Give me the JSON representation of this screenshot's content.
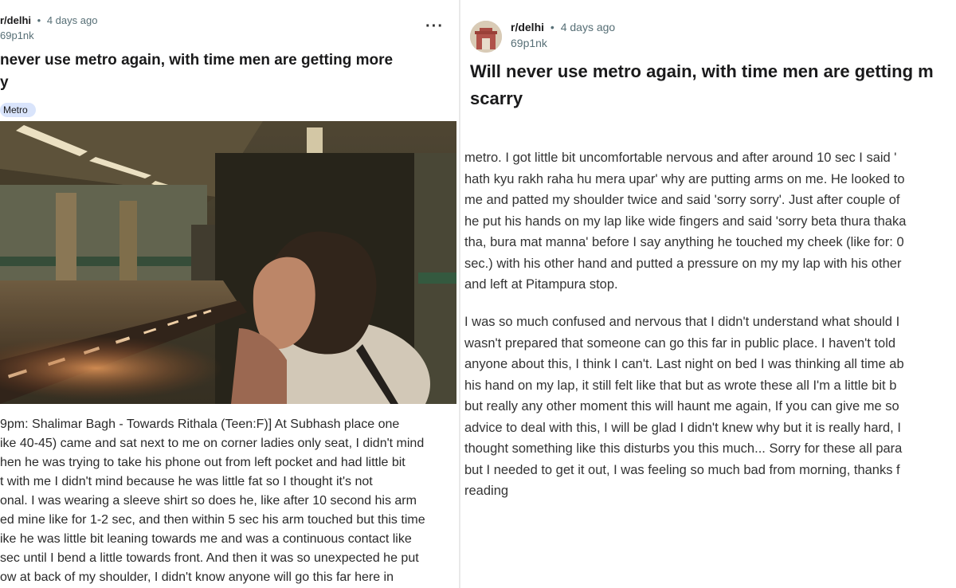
{
  "left": {
    "subreddit": "r/delhi",
    "separator": "•",
    "age": "4 days ago",
    "username": "69p1nk",
    "more_label": "···",
    "title_lines": [
      "never use metro again, with time men are getting more",
      "y"
    ],
    "flair": "Metro",
    "body_lines": [
      "9pm: Shalimar Bagh - Towards Rithala (Teen:F)] At Subhash place one",
      "ike 40-45) came and sat next to me on corner ladies only seat, I didn't mind",
      "hen he was trying to take his phone out from left pocket and had little bit",
      "t with me I didn't mind because he was little fat so I thought it's not",
      "onal. I was wearing a sleeve shirt so does he, like after 10 second his arm",
      "ed mine like for 1-2 sec, and then within 5 sec his arm touched but this time",
      "ike he was little bit leaning towards me and was a continuous contact like",
      "sec until I bend a little towards front. And then it was so unexpected he put",
      "ow at back of my shoulder, I didn't know anyone will go this far here in"
    ]
  },
  "right": {
    "subreddit": "r/delhi",
    "separator": "•",
    "age": "4 days ago",
    "username": "69p1nk",
    "title_lines": [
      "Will never use metro again, with time men are getting m",
      "scarry"
    ],
    "paragraph1": [
      "metro. I got little bit uncomfortable nervous and after around 10 sec I said '",
      "hath kyu rakh raha hu mera upar' why are putting arms on me. He looked to",
      "me and patted my shoulder twice and said 'sorry sorry'. Just after couple of",
      "he put his hands on my lap like wide fingers and said 'sorry beta thura thaka",
      "tha, bura mat manna' before I say anything he touched my cheek (like for: 0",
      "sec.) with his other hand and putted a pressure on my my lap with his other",
      "and left at Pitampura stop."
    ],
    "paragraph2": [
      "I was so much confused and nervous that I didn't understand what should I",
      "wasn't prepared that someone can go this far in public place. I haven't told",
      "anyone about this, I think I can't. Last night on bed I was thinking all time ab",
      "his hand on my lap, it still felt like that but as wrote these all I'm a little bit b",
      "but really any other moment this will haunt me again, If you can give me so",
      "advice to deal with this, I will be glad I didn't knew why but it is really hard, I",
      "thought something like this disturbs you this much... Sorry for these all para",
      "but I needed to get it out, I was feeling so much bad from morning, thanks f",
      "reading"
    ]
  },
  "colors": {
    "flair_bg": "#d9e4fb",
    "meta_gray": "#576f76",
    "text_dark": "#1a1a1b"
  }
}
